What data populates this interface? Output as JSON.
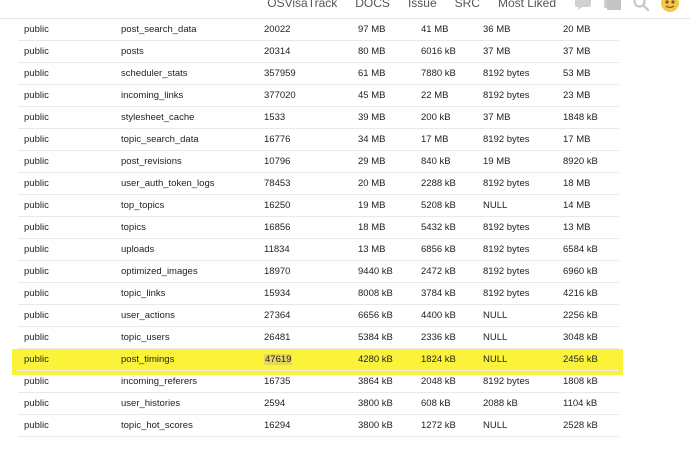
{
  "header": {
    "nav": [
      "OSVisaTrack",
      "DOCS",
      "Issue",
      "SRC",
      "Most Liked"
    ],
    "icons": [
      "chat-bubble-icon",
      "gallery-icon",
      "search-icon",
      "avatar-icon"
    ]
  },
  "colors": {
    "highlight": "#fbf33a",
    "text": "#222222",
    "row_border": "#e9e9e9"
  },
  "table": {
    "rows": [
      [
        "public",
        "post_search_data",
        "20022",
        "97 MB",
        "41 MB",
        "36 MB",
        "20 MB"
      ],
      [
        "public",
        "posts",
        "20314",
        "80 MB",
        "6016 kB",
        "37 MB",
        "37 MB"
      ],
      [
        "public",
        "scheduler_stats",
        "357959",
        "61 MB",
        "7880 kB",
        "8192 bytes",
        "53 MB"
      ],
      [
        "public",
        "incoming_links",
        "377020",
        "45 MB",
        "22 MB",
        "8192 bytes",
        "23 MB"
      ],
      [
        "public",
        "stylesheet_cache",
        "1533",
        "39 MB",
        "200 kB",
        "37 MB",
        "1848 kB"
      ],
      [
        "public",
        "topic_search_data",
        "16776",
        "34 MB",
        "17 MB",
        "8192 bytes",
        "17 MB"
      ],
      [
        "public",
        "post_revisions",
        "10796",
        "29 MB",
        "840 kB",
        "19 MB",
        "8920 kB"
      ],
      [
        "public",
        "user_auth_token_logs",
        "78453",
        "20 MB",
        "2288 kB",
        "8192 bytes",
        "18 MB"
      ],
      [
        "public",
        "top_topics",
        "16250",
        "19 MB",
        "5208 kB",
        "NULL",
        "14 MB"
      ],
      [
        "public",
        "topics",
        "16856",
        "18 MB",
        "5432 kB",
        "8192 bytes",
        "13 MB"
      ],
      [
        "public",
        "uploads",
        "11834",
        "13 MB",
        "6856 kB",
        "8192 bytes",
        "6584 kB"
      ],
      [
        "public",
        "optimized_images",
        "18970",
        "9440 kB",
        "2472 kB",
        "8192 bytes",
        "6960 kB"
      ],
      [
        "public",
        "topic_links",
        "15934",
        "8008 kB",
        "3784 kB",
        "8192 bytes",
        "4216 kB"
      ],
      [
        "public",
        "user_actions",
        "27364",
        "6656 kB",
        "4400 kB",
        "NULL",
        "2256 kB"
      ],
      [
        "public",
        "topic_users",
        "26481",
        "5384 kB",
        "2336 kB",
        "NULL",
        "3048 kB"
      ],
      [
        "public",
        "post_timings",
        "47619",
        "4280 kB",
        "1824 kB",
        "NULL",
        "2456 kB"
      ],
      [
        "public",
        "incoming_referers",
        "16735",
        "3864 kB",
        "2048 kB",
        "8192 bytes",
        "1808 kB"
      ],
      [
        "public",
        "user_histories",
        "2594",
        "3800 kB",
        "608 kB",
        "2088 kB",
        "1104 kB"
      ],
      [
        "public",
        "topic_hot_scores",
        "16294",
        "3800 kB",
        "1272 kB",
        "NULL",
        "2528 kB"
      ]
    ],
    "highlighted_row_index": 15
  }
}
